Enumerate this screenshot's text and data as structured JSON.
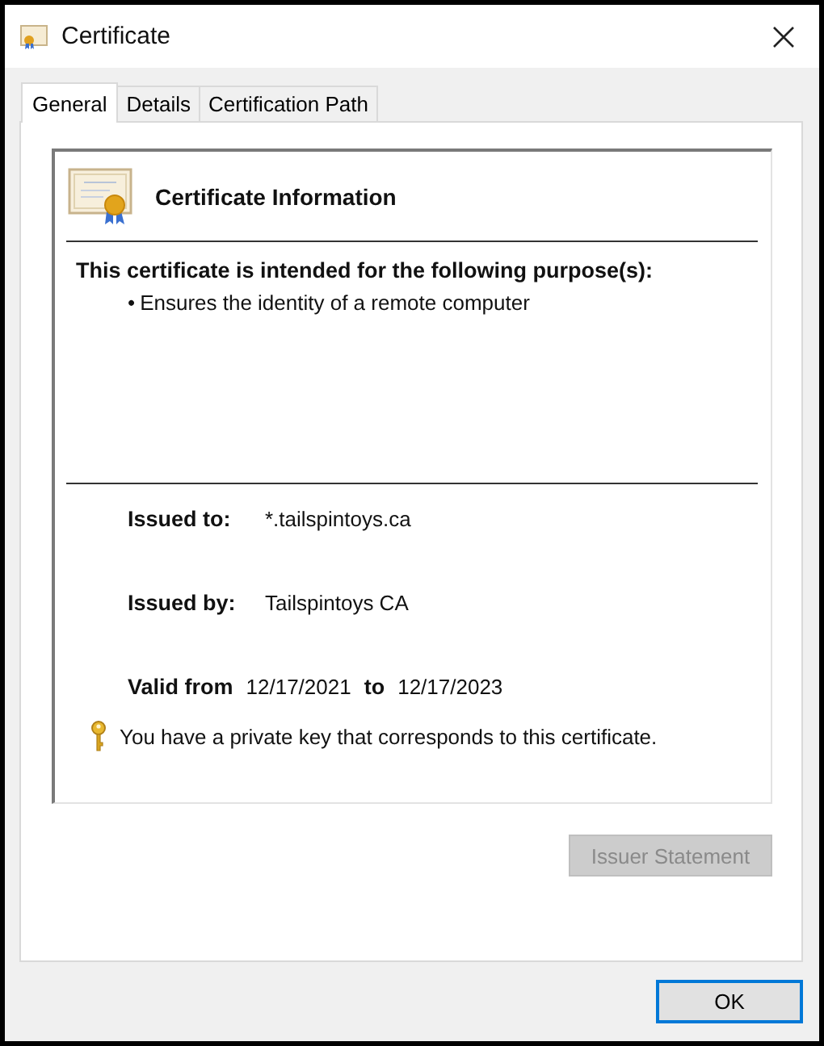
{
  "window": {
    "title": "Certificate"
  },
  "tabs": [
    {
      "label": "General",
      "selected": true
    },
    {
      "label": "Details",
      "selected": false
    },
    {
      "label": "Certification Path",
      "selected": false
    }
  ],
  "header": "Certificate Information",
  "purpose_heading": "This certificate is intended for the following purpose(s):",
  "purposes": [
    {
      "bullet": "•",
      "text": "Ensures the identity of a remote computer"
    }
  ],
  "fields": [
    {
      "label": "Issued to:",
      "value": "*.tailspintoys.ca"
    },
    {
      "label": "Issued by:",
      "value": "Tailspintoys CA"
    }
  ],
  "validity": {
    "label": "Valid from",
    "from": "12/17/2021",
    "to_label": "to",
    "to": "12/17/2023"
  },
  "private_key_note": "You have a private key that corresponds to this certificate.",
  "issuer_statement": {
    "label": "Issuer Statement",
    "disabled": true
  },
  "ok": {
    "label": "OK",
    "focused": true
  }
}
